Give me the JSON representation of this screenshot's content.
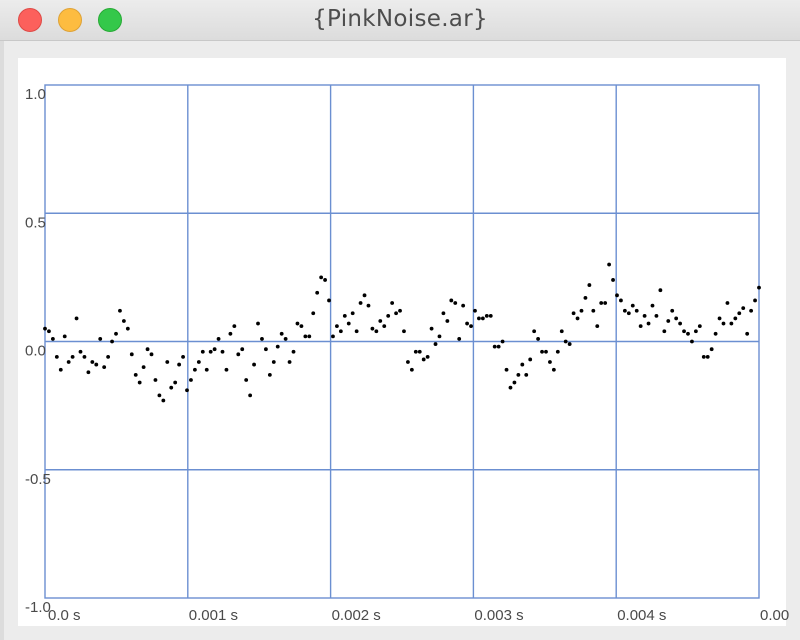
{
  "window": {
    "title": "{PinkNoise.ar}"
  },
  "colors": {
    "grid": "#6b8fd1",
    "points": "#000000",
    "background": "#ffffff"
  },
  "chart_data": {
    "type": "scatter",
    "title": "",
    "xlabel": "",
    "ylabel": "",
    "xlim": [
      0.0,
      0.005
    ],
    "ylim": [
      -1.0,
      1.0
    ],
    "grid": true,
    "x_ticks": [
      {
        "value": 0.0,
        "label": "0.0 s"
      },
      {
        "value": 0.001,
        "label": "0.001 s"
      },
      {
        "value": 0.002,
        "label": "0.002 s"
      },
      {
        "value": 0.003,
        "label": "0.003 s"
      },
      {
        "value": 0.004,
        "label": "0.004 s"
      },
      {
        "value": 0.005,
        "label": "0.00"
      }
    ],
    "y_ticks": [
      {
        "value": 1.0,
        "label": "1.0"
      },
      {
        "value": 0.5,
        "label": "0.5"
      },
      {
        "value": 0.0,
        "label": "0.0"
      },
      {
        "value": -0.5,
        "label": "-0.5"
      },
      {
        "value": -1.0,
        "label": "-1.0"
      }
    ],
    "series": [
      {
        "values": [
          0.05,
          0.04,
          0.01,
          -0.06,
          -0.11,
          0.02,
          -0.08,
          -0.06,
          0.09,
          -0.04,
          -0.06,
          -0.12,
          -0.08,
          -0.09,
          0.01,
          -0.1,
          -0.06,
          0.0,
          0.03,
          0.12,
          0.08,
          0.05,
          -0.05,
          -0.13,
          -0.16,
          -0.1,
          -0.03,
          -0.05,
          -0.15,
          -0.21,
          -0.23,
          -0.08,
          -0.18,
          -0.16,
          -0.09,
          -0.06,
          -0.19,
          -0.15,
          -0.11,
          -0.08,
          -0.04,
          -0.11,
          -0.04,
          -0.03,
          0.01,
          -0.04,
          -0.11,
          0.03,
          0.06,
          -0.05,
          -0.03,
          -0.15,
          -0.21,
          -0.09,
          0.07,
          0.01,
          -0.03,
          -0.13,
          -0.08,
          -0.02,
          0.03,
          0.01,
          -0.08,
          -0.04,
          0.07,
          0.06,
          0.02,
          0.02,
          0.11,
          0.19,
          0.25,
          0.24,
          0.16,
          0.02,
          0.06,
          0.04,
          0.1,
          0.07,
          0.11,
          0.04,
          0.15,
          0.18,
          0.14,
          0.05,
          0.04,
          0.08,
          0.06,
          0.1,
          0.15,
          0.11,
          0.12,
          0.04,
          -0.08,
          -0.11,
          -0.04,
          -0.04,
          -0.07,
          -0.06,
          0.05,
          -0.01,
          0.02,
          0.11,
          0.08,
          0.16,
          0.15,
          0.01,
          0.14,
          0.07,
          0.06,
          0.12,
          0.09,
          0.09,
          0.1,
          0.1,
          -0.02,
          -0.02,
          0.0,
          -0.11,
          -0.18,
          -0.16,
          -0.13,
          -0.09,
          -0.13,
          -0.07,
          0.04,
          0.01,
          -0.04,
          -0.04,
          -0.08,
          -0.11,
          -0.04,
          0.04,
          0.0,
          -0.01,
          0.11,
          0.09,
          0.12,
          0.17,
          0.22,
          0.12,
          0.06,
          0.15,
          0.15,
          0.3,
          0.24,
          0.18,
          0.16,
          0.12,
          0.11,
          0.14,
          0.12,
          0.06,
          0.1,
          0.07,
          0.14,
          0.1,
          0.2,
          0.04,
          0.08,
          0.12,
          0.09,
          0.07,
          0.04,
          0.03,
          0.0,
          0.04,
          0.06,
          -0.06,
          -0.06,
          -0.03,
          0.03,
          0.09,
          0.07,
          0.15,
          0.07,
          0.09,
          0.11,
          0.13,
          0.03,
          0.12,
          0.16,
          0.21
        ]
      }
    ]
  }
}
